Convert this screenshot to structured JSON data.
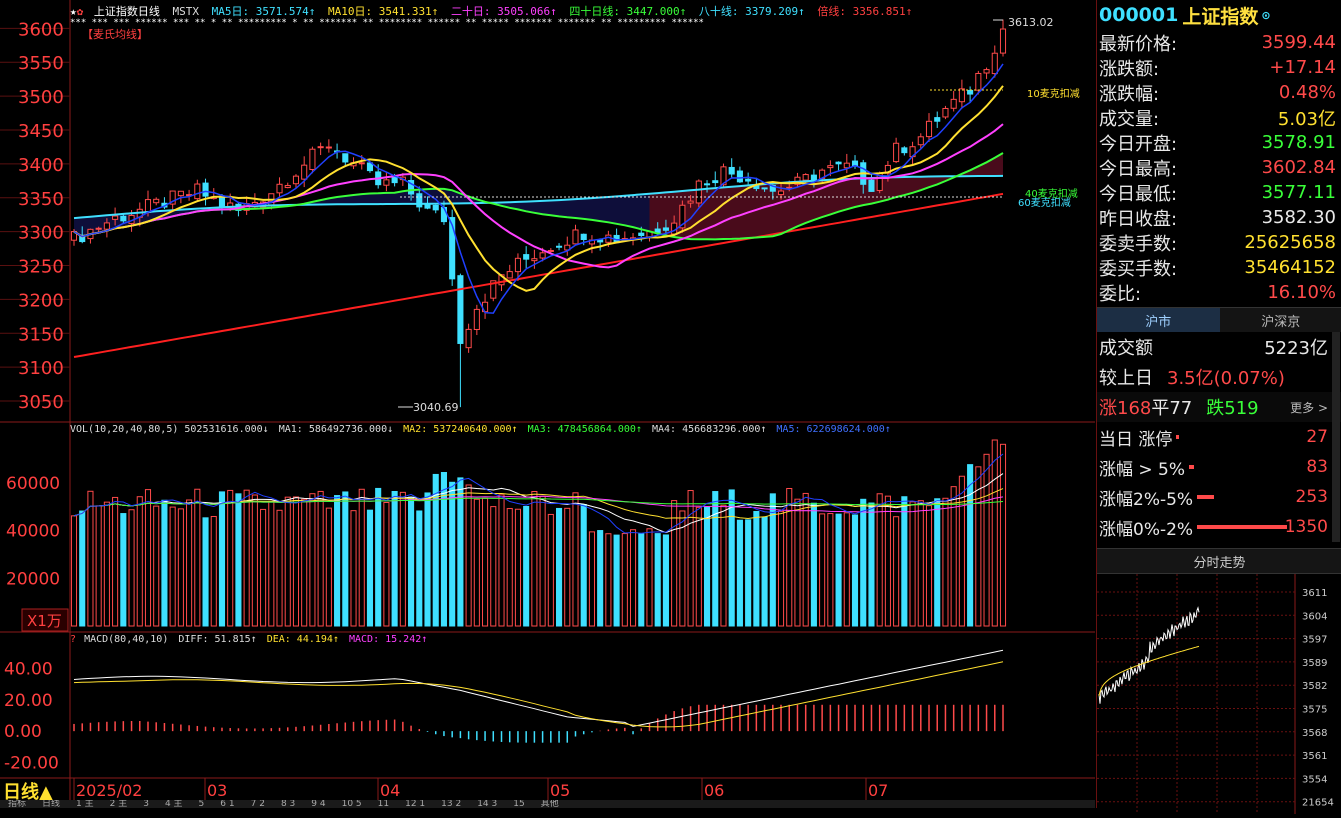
{
  "main_chart": {
    "period_label": "日线",
    "price_axis": [
      3600,
      3550,
      3500,
      3450,
      3400,
      3350,
      3300,
      3250,
      3200,
      3150,
      3100,
      3050
    ],
    "ylim": [
      3025,
      3630
    ],
    "header": {
      "name": "上证指数",
      "period": "日线",
      "indicator": "MSTX",
      "ma5": "MA5日: 3571.574↑",
      "ma10": "MA10日: 3541.331↑",
      "ma20": "二十日: 3505.066↑",
      "ma40": "四十日线: 3447.000↑",
      "ma80": "八十线: 3379.209↑",
      "ma_long": "倍线: 3356.851↑"
    },
    "tag": "【麦氏均线】",
    "high_label": "3613.02",
    "low_label": "3040.69",
    "deduct_labels": [
      "10麦克扣减",
      "40麦克扣减",
      "60麦克扣减"
    ],
    "months": [
      "2025/02",
      "03",
      "04",
      "05",
      "06",
      "07"
    ]
  },
  "volume_panel": {
    "header": {
      "title": "VOL(10,20,40,80,5) 502531616.000↓",
      "ma1": "MA1: 586492736.000↓",
      "ma2": "MA2: 537240640.000↑",
      "ma3": "MA3: 478456864.000↑",
      "ma4": "MA4: 456683296.000↑",
      "ma5": "MA5: 622698624.000↑"
    },
    "axis": [
      "60000",
      "40000",
      "20000"
    ],
    "unit_label": "X1万"
  },
  "macd_panel": {
    "header": {
      "title": "MACD(80,40,10)",
      "diff": "DIFF: 51.815↑",
      "dea": "DEA: 44.194↑",
      "macd": "MACD: 15.242↑"
    },
    "axis": [
      "40.00",
      "20.00",
      "0.00",
      "-20.00"
    ]
  },
  "quote": {
    "code": "000001",
    "name": "上证指数",
    "rows": [
      {
        "label": "最新价格:",
        "value": "3599.44",
        "color": "#ff4a4a"
      },
      {
        "label": "涨跌额:",
        "value": "+17.14",
        "color": "#ff4a4a"
      },
      {
        "label": "涨跌幅:",
        "value": "0.48%",
        "color": "#ff4a4a"
      },
      {
        "label": "成交量:",
        "value": "5.03亿",
        "color": "#ffe030"
      },
      {
        "label": "今日开盘:",
        "value": "3578.91",
        "color": "#39ff39"
      },
      {
        "label": "今日最高:",
        "value": "3602.84",
        "color": "#ff4a4a"
      },
      {
        "label": "今日最低:",
        "value": "3577.11",
        "color": "#39ff39"
      },
      {
        "label": "昨日收盘:",
        "value": "3582.30",
        "color": "#e8e8e8"
      },
      {
        "label": "委卖手数:",
        "value": "25625658",
        "color": "#ffe030"
      },
      {
        "label": "委买手数:",
        "value": "35464152",
        "color": "#ffe030"
      },
      {
        "label": "委比:",
        "value": "16.10%",
        "color": "#ff4a4a"
      }
    ]
  },
  "market": {
    "tabs": [
      "沪市",
      "沪深京"
    ],
    "turnover_label": "成交额",
    "turnover_value": "5223亿",
    "vs_prev_label": "较上日",
    "vs_prev_value": "3.5亿(0.07%)",
    "up_label": "涨168",
    "flat_label": "平77",
    "down_label": "跌519",
    "more_label": "更多 >",
    "stats": [
      {
        "label": "当日 涨停",
        "value": "27",
        "fraction": 0.02
      },
      {
        "label": "涨幅 > 5%",
        "value": "83",
        "fraction": 0.06
      },
      {
        "label": "涨幅2%-5%",
        "value": "253",
        "fraction": 0.19
      },
      {
        "label": "涨幅0%-2%",
        "value": "1350",
        "fraction": 1.0
      }
    ]
  },
  "intraday": {
    "title": "分时走势",
    "axis": [
      "3611",
      "3604",
      "3597",
      "3589",
      "3582",
      "3575",
      "3568",
      "3561",
      "3554",
      "21654"
    ]
  },
  "bottom_tabs": [
    "指标",
    "日线",
    "1 主",
    "2 主",
    "3",
    "4 主",
    "5",
    "6 1",
    "7 2",
    "8 3",
    "9 4",
    "10 5",
    "11",
    "12 1",
    "13 2",
    "14 3",
    "15",
    "其他"
  ]
}
